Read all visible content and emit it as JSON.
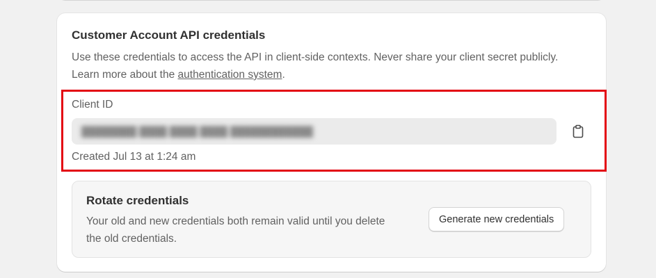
{
  "card": {
    "title": "Customer Account API credentials",
    "description": "Use these credentials to access the API in client-side contexts. Never share your client secret publicly. Learn more about the ",
    "link_text": "authentication system",
    "description_end": "."
  },
  "client_id": {
    "label": "Client ID",
    "value": "",
    "created": "Created Jul 13 at 1:24 am",
    "copy_icon": "clipboard-icon"
  },
  "rotate": {
    "title": "Rotate credentials",
    "description": "Your old and new credentials both remain valid until you delete the old credentials.",
    "button_label": "Generate new credentials"
  },
  "colors": {
    "highlight": "#e30613"
  }
}
